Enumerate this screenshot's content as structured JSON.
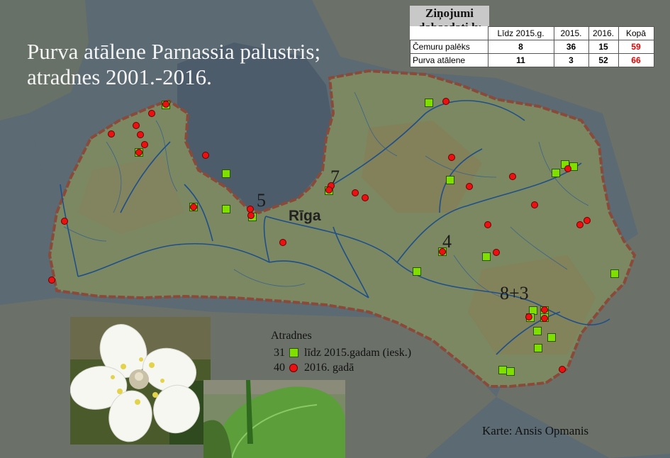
{
  "title": {
    "line1": "Purva atālene Parnassia palustris;",
    "line2": "atradnes 2001.-2016."
  },
  "city_label": "Rīga",
  "counts": {
    "a": "7",
    "b": "5",
    "c": "4",
    "d": "8+3"
  },
  "stats": {
    "header_line1": "Ziņojumi",
    "header_line2": "dabasdati.lv",
    "columns": [
      "Līdz 2015.g.",
      "2015.",
      "2016.",
      "Kopā"
    ],
    "rows": [
      {
        "name": "Čemuru palēks",
        "values": [
          "8",
          "36",
          "15",
          "59"
        ]
      },
      {
        "name": "Purva atālene",
        "values": [
          "11",
          "3",
          "52",
          "66"
        ]
      }
    ]
  },
  "legend": {
    "title": "Atradnes",
    "items": [
      {
        "count": "31",
        "label": "līdz 2015.gadam (iesk.)",
        "symbol": "square",
        "color": "#7fe000"
      },
      {
        "count": "40",
        "label": "2016. gadā",
        "symbol": "circle",
        "color": "#ee1010"
      }
    ]
  },
  "author": "Karte: Ansis Opmanis",
  "colors": {
    "sea": "#5a6a72",
    "land": "#7f8c63",
    "border": "#8a4a3a",
    "river": "#1f4f8a",
    "old_record": "#7fe000",
    "new_record": "#ee1010"
  }
}
